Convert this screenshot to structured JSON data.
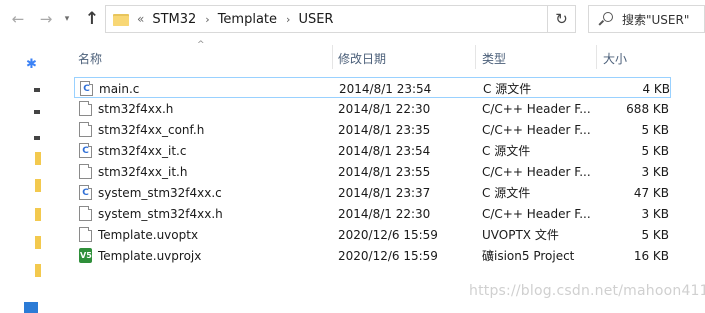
{
  "navigation": {
    "back_icon": "arrow-left-icon",
    "forward_icon": "arrow-right-icon",
    "recent_icon": "chevron-down-icon",
    "up_icon": "arrow-up-icon"
  },
  "address_bar": {
    "overflow_indicator": "«",
    "breadcrumbs": [
      "STM32",
      "Template",
      "USER"
    ]
  },
  "search": {
    "placeholder": "搜索\"USER\""
  },
  "columns": {
    "name": "名称",
    "date": "修改日期",
    "type": "类型",
    "size": "大小"
  },
  "files": [
    {
      "name": "main.c",
      "date": "2014/8/1 23:54",
      "type": "C 源文件",
      "size": "4 KB",
      "icon": "c-source-icon",
      "selected": true
    },
    {
      "name": "stm32f4xx.h",
      "date": "2014/8/1 22:30",
      "type": "C/C++ Header F...",
      "size": "688 KB",
      "icon": "header-file-icon"
    },
    {
      "name": "stm32f4xx_conf.h",
      "date": "2014/8/1 23:35",
      "type": "C/C++ Header F...",
      "size": "5 KB",
      "icon": "header-file-icon"
    },
    {
      "name": "stm32f4xx_it.c",
      "date": "2014/8/1 23:54",
      "type": "C 源文件",
      "size": "5 KB",
      "icon": "c-source-icon"
    },
    {
      "name": "stm32f4xx_it.h",
      "date": "2014/8/1 23:55",
      "type": "C/C++ Header F...",
      "size": "3 KB",
      "icon": "header-file-icon"
    },
    {
      "name": "system_stm32f4xx.c",
      "date": "2014/8/1 23:37",
      "type": "C 源文件",
      "size": "47 KB",
      "icon": "c-source-icon"
    },
    {
      "name": "system_stm32f4xx.h",
      "date": "2014/8/1 22:30",
      "type": "C/C++ Header F...",
      "size": "3 KB",
      "icon": "header-file-icon"
    },
    {
      "name": "Template.uvoptx",
      "date": "2020/12/6 15:59",
      "type": "UVOPTX 文件",
      "size": "5 KB",
      "icon": "generic-file-icon"
    },
    {
      "name": "Template.uvprojx",
      "date": "2020/12/6 15:59",
      "type": "礦ision5 Project",
      "size": "16 KB",
      "icon": "keil-project-icon"
    }
  ],
  "watermark": "https://blog.csdn.net/mahoon411",
  "colors": {
    "header_text": "#4c607a",
    "selection_border": "#99d1ff",
    "folder_yellow": "#f8d775",
    "c_glyph_blue": "#2f6fd6",
    "keil_green": "#2f8f3a"
  }
}
